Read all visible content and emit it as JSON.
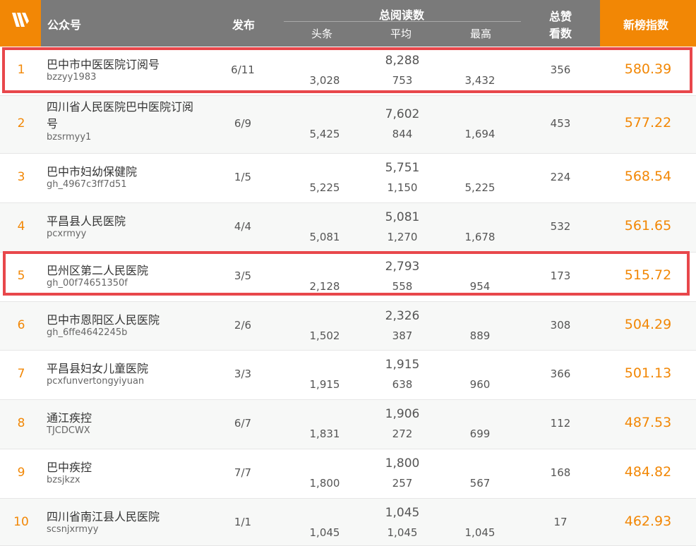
{
  "header": {
    "account": "公众号",
    "publish": "发布",
    "total_reads": "总阅读数",
    "headline": "头条",
    "average": "平均",
    "highest": "最高",
    "total_likes_line1": "总赞",
    "total_likes_line2": "看数",
    "index": "新榜指数"
  },
  "rows": [
    {
      "rank": "1",
      "name": "巴中市中医医院订阅号",
      "account": "bzzyy1983",
      "publish": "6/11",
      "total": "8,288",
      "headline": "3,028",
      "average": "753",
      "highest": "3,432",
      "likes": "356",
      "score": "580.39"
    },
    {
      "rank": "2",
      "name": "四川省人民医院巴中医院订阅",
      "name2": "号",
      "account": "bzsrmyy1",
      "publish": "6/9",
      "total": "7,602",
      "headline": "5,425",
      "average": "844",
      "highest": "1,694",
      "likes": "453",
      "score": "577.22"
    },
    {
      "rank": "3",
      "name": "巴中市妇幼保健院",
      "account": "gh_4967c3ff7d51",
      "publish": "1/5",
      "total": "5,751",
      "headline": "5,225",
      "average": "1,150",
      "highest": "5,225",
      "likes": "224",
      "score": "568.54"
    },
    {
      "rank": "4",
      "name": "平昌县人民医院",
      "account": "pcxrmyy",
      "publish": "4/4",
      "total": "5,081",
      "headline": "5,081",
      "average": "1,270",
      "highest": "1,678",
      "likes": "532",
      "score": "561.65"
    },
    {
      "rank": "5",
      "name": "巴州区第二人民医院",
      "account": "gh_00f74651350f",
      "publish": "3/5",
      "total": "2,793",
      "headline": "2,128",
      "average": "558",
      "highest": "954",
      "likes": "173",
      "score": "515.72"
    },
    {
      "rank": "6",
      "name": "巴中市恩阳区人民医院",
      "account": "gh_6ffe4642245b",
      "publish": "2/6",
      "total": "2,326",
      "headline": "1,502",
      "average": "387",
      "highest": "889",
      "likes": "308",
      "score": "504.29"
    },
    {
      "rank": "7",
      "name": "平昌县妇女儿童医院",
      "account": "pcxfunvertongyiyuan",
      "publish": "3/3",
      "total": "1,915",
      "headline": "1,915",
      "average": "638",
      "highest": "960",
      "likes": "366",
      "score": "501.13"
    },
    {
      "rank": "8",
      "name": "通江疾控",
      "account": "TJCDCWX",
      "publish": "6/7",
      "total": "1,906",
      "headline": "1,831",
      "average": "272",
      "highest": "699",
      "likes": "112",
      "score": "487.53"
    },
    {
      "rank": "9",
      "name": "巴中疾控",
      "account": "bzsjkzx",
      "publish": "7/7",
      "total": "1,800",
      "headline": "1,800",
      "average": "257",
      "highest": "567",
      "likes": "168",
      "score": "484.82"
    },
    {
      "rank": "10",
      "name": "四川省南江县人民医院",
      "account": "scsnjxrmyy",
      "publish": "1/1",
      "total": "1,045",
      "headline": "1,045",
      "average": "1,045",
      "highest": "1,045",
      "likes": "17",
      "score": "462.93"
    }
  ],
  "colors": {
    "accent": "#f28705",
    "header_bg": "#7a7a7a",
    "highlight": "#e8474b",
    "row_alt": "#f7f8f7"
  },
  "icons": {
    "logo": "newrank-logo-icon"
  }
}
